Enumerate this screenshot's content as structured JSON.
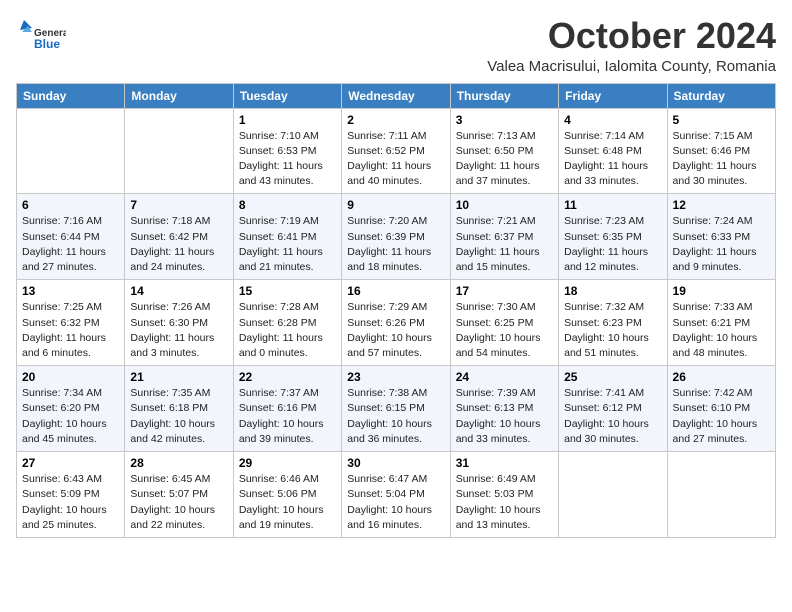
{
  "header": {
    "logo": {
      "general": "General",
      "blue": "Blue"
    },
    "month": "October 2024",
    "location": "Valea Macrisului, Ialomita County, Romania"
  },
  "weekdays": [
    "Sunday",
    "Monday",
    "Tuesday",
    "Wednesday",
    "Thursday",
    "Friday",
    "Saturday"
  ],
  "weeks": [
    [
      {
        "day": "",
        "content": ""
      },
      {
        "day": "",
        "content": ""
      },
      {
        "day": "1",
        "content": "Sunrise: 7:10 AM\nSunset: 6:53 PM\nDaylight: 11 hours and 43 minutes."
      },
      {
        "day": "2",
        "content": "Sunrise: 7:11 AM\nSunset: 6:52 PM\nDaylight: 11 hours and 40 minutes."
      },
      {
        "day": "3",
        "content": "Sunrise: 7:13 AM\nSunset: 6:50 PM\nDaylight: 11 hours and 37 minutes."
      },
      {
        "day": "4",
        "content": "Sunrise: 7:14 AM\nSunset: 6:48 PM\nDaylight: 11 hours and 33 minutes."
      },
      {
        "day": "5",
        "content": "Sunrise: 7:15 AM\nSunset: 6:46 PM\nDaylight: 11 hours and 30 minutes."
      }
    ],
    [
      {
        "day": "6",
        "content": "Sunrise: 7:16 AM\nSunset: 6:44 PM\nDaylight: 11 hours and 27 minutes."
      },
      {
        "day": "7",
        "content": "Sunrise: 7:18 AM\nSunset: 6:42 PM\nDaylight: 11 hours and 24 minutes."
      },
      {
        "day": "8",
        "content": "Sunrise: 7:19 AM\nSunset: 6:41 PM\nDaylight: 11 hours and 21 minutes."
      },
      {
        "day": "9",
        "content": "Sunrise: 7:20 AM\nSunset: 6:39 PM\nDaylight: 11 hours and 18 minutes."
      },
      {
        "day": "10",
        "content": "Sunrise: 7:21 AM\nSunset: 6:37 PM\nDaylight: 11 hours and 15 minutes."
      },
      {
        "day": "11",
        "content": "Sunrise: 7:23 AM\nSunset: 6:35 PM\nDaylight: 11 hours and 12 minutes."
      },
      {
        "day": "12",
        "content": "Sunrise: 7:24 AM\nSunset: 6:33 PM\nDaylight: 11 hours and 9 minutes."
      }
    ],
    [
      {
        "day": "13",
        "content": "Sunrise: 7:25 AM\nSunset: 6:32 PM\nDaylight: 11 hours and 6 minutes."
      },
      {
        "day": "14",
        "content": "Sunrise: 7:26 AM\nSunset: 6:30 PM\nDaylight: 11 hours and 3 minutes."
      },
      {
        "day": "15",
        "content": "Sunrise: 7:28 AM\nSunset: 6:28 PM\nDaylight: 11 hours and 0 minutes."
      },
      {
        "day": "16",
        "content": "Sunrise: 7:29 AM\nSunset: 6:26 PM\nDaylight: 10 hours and 57 minutes."
      },
      {
        "day": "17",
        "content": "Sunrise: 7:30 AM\nSunset: 6:25 PM\nDaylight: 10 hours and 54 minutes."
      },
      {
        "day": "18",
        "content": "Sunrise: 7:32 AM\nSunset: 6:23 PM\nDaylight: 10 hours and 51 minutes."
      },
      {
        "day": "19",
        "content": "Sunrise: 7:33 AM\nSunset: 6:21 PM\nDaylight: 10 hours and 48 minutes."
      }
    ],
    [
      {
        "day": "20",
        "content": "Sunrise: 7:34 AM\nSunset: 6:20 PM\nDaylight: 10 hours and 45 minutes."
      },
      {
        "day": "21",
        "content": "Sunrise: 7:35 AM\nSunset: 6:18 PM\nDaylight: 10 hours and 42 minutes."
      },
      {
        "day": "22",
        "content": "Sunrise: 7:37 AM\nSunset: 6:16 PM\nDaylight: 10 hours and 39 minutes."
      },
      {
        "day": "23",
        "content": "Sunrise: 7:38 AM\nSunset: 6:15 PM\nDaylight: 10 hours and 36 minutes."
      },
      {
        "day": "24",
        "content": "Sunrise: 7:39 AM\nSunset: 6:13 PM\nDaylight: 10 hours and 33 minutes."
      },
      {
        "day": "25",
        "content": "Sunrise: 7:41 AM\nSunset: 6:12 PM\nDaylight: 10 hours and 30 minutes."
      },
      {
        "day": "26",
        "content": "Sunrise: 7:42 AM\nSunset: 6:10 PM\nDaylight: 10 hours and 27 minutes."
      }
    ],
    [
      {
        "day": "27",
        "content": "Sunrise: 6:43 AM\nSunset: 5:09 PM\nDaylight: 10 hours and 25 minutes."
      },
      {
        "day": "28",
        "content": "Sunrise: 6:45 AM\nSunset: 5:07 PM\nDaylight: 10 hours and 22 minutes."
      },
      {
        "day": "29",
        "content": "Sunrise: 6:46 AM\nSunset: 5:06 PM\nDaylight: 10 hours and 19 minutes."
      },
      {
        "day": "30",
        "content": "Sunrise: 6:47 AM\nSunset: 5:04 PM\nDaylight: 10 hours and 16 minutes."
      },
      {
        "day": "31",
        "content": "Sunrise: 6:49 AM\nSunset: 5:03 PM\nDaylight: 10 hours and 13 minutes."
      },
      {
        "day": "",
        "content": ""
      },
      {
        "day": "",
        "content": ""
      }
    ]
  ]
}
